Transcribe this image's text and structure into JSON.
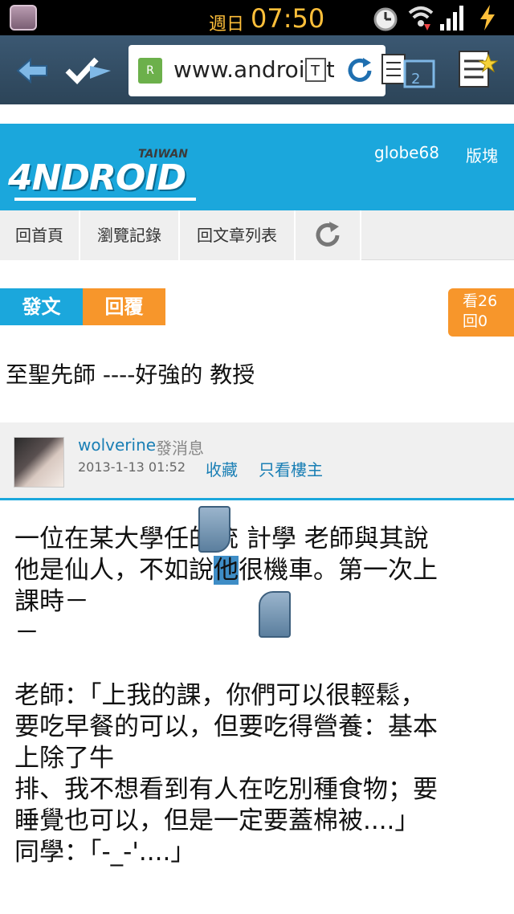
{
  "status_bar": {
    "weekday": "週日",
    "time": "07:50",
    "icons": [
      "app-icon",
      "alarm-icon",
      "wifi-icon",
      "signal-icon",
      "charging-icon"
    ]
  },
  "address_bar": {
    "url": "www.android.tw",
    "tab_count": "2",
    "icons": [
      "back-icon",
      "bookmark-check-icon",
      "text-size-icon",
      "refresh-icon",
      "tabs-icon",
      "menu-star-icon"
    ]
  },
  "site_header": {
    "logo_word": "4NDROID",
    "logo_tag": "TAIWAN",
    "user_link": "globe68",
    "forum_link": "版塊"
  },
  "nav_tabs": [
    "回首頁",
    "瀏覽記錄",
    "回文章列表"
  ],
  "actions": {
    "post": "發文",
    "reply": "回覆",
    "views": "看26",
    "replies": "回0"
  },
  "thread": {
    "title": "至聖先師 ----好強的 教授"
  },
  "author": {
    "name": "wolverine",
    "message": "發消息",
    "date": "2013-1-13 01:52",
    "favorite": "收藏",
    "owner_only": "只看樓主"
  },
  "post": {
    "line1_pre": "一位在某大學任",
    "line1_post": "的統 計學 老師與其說",
    "line2_pre": "他是仙人，不如說",
    "line2_sel": "他",
    "line2_post": "很機車。第一次上",
    "line3": "課時－",
    "line4": "－",
    "para2": "老師：「上我的課，你們可以很輕鬆，\n要吃早餐的可以，但要吃得營養：基本\n上除了牛\n排、我不想看到有人在吃別種食物；要\n睡覺也可以，但是一定要蓋棉被....」\n同學：「-_-'....」"
  },
  "colors": {
    "header_blue": "#1ba7dc",
    "accent_orange": "#f7962b",
    "link_blue": "#1a7fb5"
  }
}
